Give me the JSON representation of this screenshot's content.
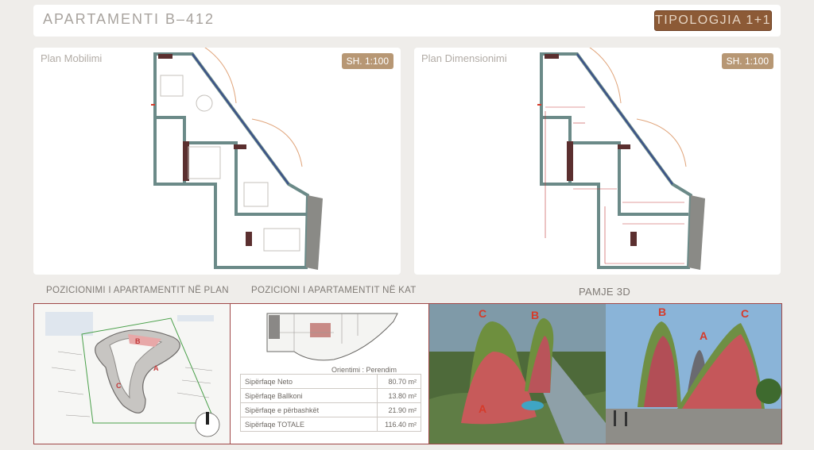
{
  "header": {
    "title": "APARTAMENTI B–412",
    "typology": "TIPOLOGJIA 1+1"
  },
  "plan_furnished": {
    "label": "Plan Mobilimi",
    "scale": "SH. 1:100"
  },
  "plan_dimension": {
    "label": "Plan Dimensionimi",
    "scale": "SH. 1:100"
  },
  "sections": {
    "position_plan": "POZICIONIMI I APARTAMENTIT NË PLAN",
    "position_floor": "POZICIONI I APARTAMENTIT NË KAT",
    "view3d": "PAMJE 3D"
  },
  "orientation": {
    "label": "Orientimi",
    "value": "Perendim"
  },
  "areas": [
    {
      "label": "Sipërfaqe Neto",
      "value": "80.70",
      "unit": "m²"
    },
    {
      "label": "Sipërfaqe Ballkoni",
      "value": "13.80",
      "unit": "m²"
    },
    {
      "label": "Sipërfaqe e përbashkët",
      "value": "21.90",
      "unit": "m²"
    },
    {
      "label": "Sipërfaqe TOTALE",
      "value": "116.40",
      "unit": "m²"
    }
  ],
  "building_letters": {
    "a": "A",
    "b": "B",
    "c": "C"
  },
  "colors": {
    "accent": "#8c5a36",
    "border": "#a04848",
    "wall": "#6b8a88",
    "marker": "#d63b2a"
  }
}
